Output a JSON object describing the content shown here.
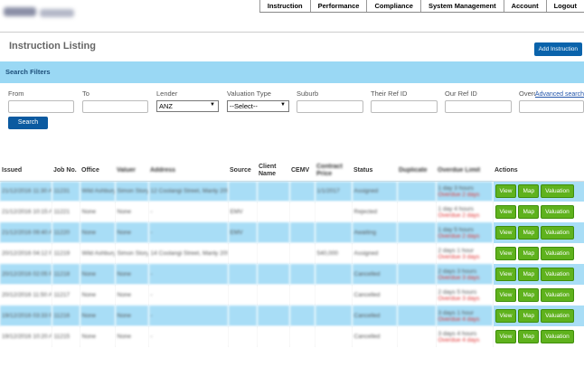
{
  "nav": {
    "items": [
      "Instruction",
      "Performance",
      "Compliance",
      "System Management",
      "Account",
      "Logout"
    ]
  },
  "title_bar": {
    "title": "Instruction Listing",
    "add_button": "Add Instruction"
  },
  "search_filters": {
    "heading": "Search Filters",
    "from_label": "From",
    "to_label": "To",
    "lender_label": "Lender",
    "lender_value": "ANZ",
    "valuation_type_label": "Valuation Type",
    "valuation_type_value": "--Select--",
    "suburb_label": "Suburb",
    "their_ref_label": "Their Ref ID",
    "our_ref_label": "Our Ref ID",
    "overdue_label": "Overdue",
    "advanced_search": "Advanced search",
    "search_button": "Search"
  },
  "table": {
    "headers": [
      "Issued",
      "Job No.",
      "Office",
      "Valuer",
      "Address",
      "Source",
      "Client Name",
      "CEMV",
      "Contract Price",
      "Status",
      "Duplicate",
      "Overdue Limit",
      "Actions"
    ],
    "action_labels": [
      "View",
      "Map",
      "Valuation"
    ],
    "rows": [
      {
        "issued": "21/12/2016 11:30 AM",
        "job": "11231",
        "office": "Wild Ashbury",
        "valuer": "Simon Story",
        "address": "12 Coolangi Street, Manly 2095",
        "source": "",
        "client": "",
        "cemv": "",
        "price": "1/1/2017",
        "status": "Assigned",
        "dup": "",
        "overdue1": "1 day 3 hours",
        "overdue2": "Overdue 2 days"
      },
      {
        "issued": "21/12/2016 10:15 AM",
        "job": "11221",
        "office": "None",
        "valuer": "None",
        "address": "-",
        "source": "EMV",
        "client": "",
        "cemv": "",
        "price": "",
        "status": "Rejected",
        "dup": "",
        "overdue1": "1 day 4 hours",
        "overdue2": "Overdue 2 days"
      },
      {
        "issued": "21/12/2016 09:40 AM",
        "job": "11220",
        "office": "None",
        "valuer": "None",
        "address": "-",
        "source": "EMV",
        "client": "",
        "cemv": "",
        "price": "",
        "status": "Awaiting",
        "dup": "",
        "overdue1": "1 day 5 hours",
        "overdue2": "Overdue 2 days"
      },
      {
        "issued": "20/12/2016 04:12 PM",
        "job": "11219",
        "office": "Wild Ashbury",
        "valuer": "Simon Story",
        "address": "14 Coolangi Street, Manly 2095",
        "source": "",
        "client": "",
        "cemv": "",
        "price": "540,000",
        "status": "Assigned",
        "dup": "",
        "overdue1": "2 days 1 hour",
        "overdue2": "Overdue 3 days"
      },
      {
        "issued": "20/12/2016 02:05 PM",
        "job": "11218",
        "office": "None",
        "valuer": "None",
        "address": "-",
        "source": "",
        "client": "",
        "cemv": "",
        "price": "",
        "status": "Cancelled",
        "dup": "",
        "overdue1": "2 days 3 hours",
        "overdue2": "Overdue 3 days"
      },
      {
        "issued": "20/12/2016 11:50 AM",
        "job": "11217",
        "office": "None",
        "valuer": "None",
        "address": "-",
        "source": "",
        "client": "",
        "cemv": "",
        "price": "",
        "status": "Cancelled",
        "dup": "",
        "overdue1": "2 days 5 hours",
        "overdue2": "Overdue 3 days"
      },
      {
        "issued": "19/12/2016 03:33 PM",
        "job": "11216",
        "office": "None",
        "valuer": "None",
        "address": "-",
        "source": "",
        "client": "",
        "cemv": "",
        "price": "",
        "status": "Cancelled",
        "dup": "",
        "overdue1": "3 days 1 hour",
        "overdue2": "Overdue 4 days"
      },
      {
        "issued": "19/12/2016 10:20 AM",
        "job": "11215",
        "office": "None",
        "valuer": "None",
        "address": "-",
        "source": "",
        "client": "",
        "cemv": "",
        "price": "",
        "status": "Cancelled",
        "dup": "",
        "overdue1": "3 days 4 hours",
        "overdue2": "Overdue 4 days"
      }
    ]
  },
  "colors": {
    "accent": "#0a63ab",
    "row_highlight": "#a8ddf6",
    "filter_bar": "#9ad8f4",
    "action_green": "#5fb21d"
  }
}
